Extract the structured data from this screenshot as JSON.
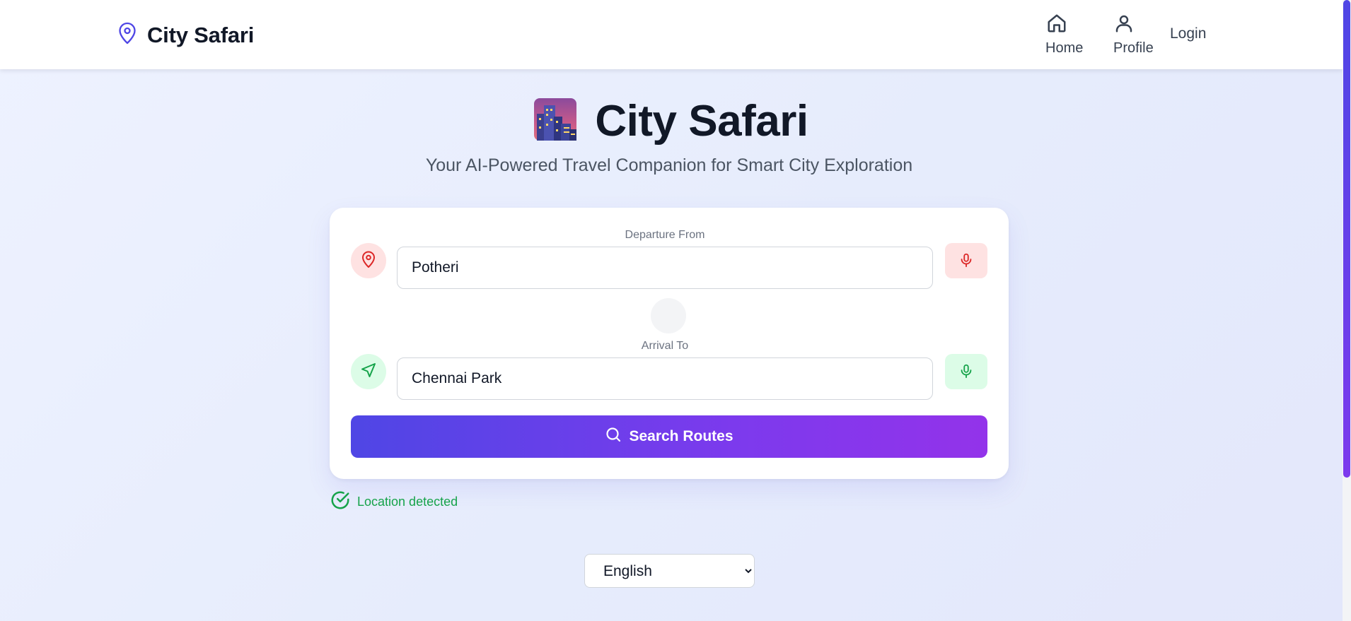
{
  "header": {
    "brand": "City Safari",
    "nav": {
      "home": "Home",
      "profile": "Profile",
      "login": "Login"
    }
  },
  "hero": {
    "emoji": "🌆",
    "title": "City Safari",
    "subtitle": "Your AI-Powered Travel Companion for Smart City Exploration"
  },
  "form": {
    "departure": {
      "label": "Departure From",
      "value": "Potheri"
    },
    "arrival": {
      "label": "Arrival To",
      "value": "Chennai Park"
    },
    "search_label": "Search Routes"
  },
  "status": {
    "text": "Location detected"
  },
  "language": {
    "selected": "English",
    "options": [
      "English"
    ]
  },
  "colors": {
    "accent": "#4f46e5",
    "accent_end": "#9333ea",
    "departure": "#dc2626",
    "arrival": "#16a34a",
    "background": "#eef2ff"
  },
  "icons": {
    "brand": "map-pin-icon",
    "home": "home-icon",
    "profile": "user-icon",
    "departure": "map-pin-icon",
    "arrival": "navigation-arrow-icon",
    "mic": "microphone-icon",
    "search": "search-icon",
    "status": "check-circle-icon"
  }
}
